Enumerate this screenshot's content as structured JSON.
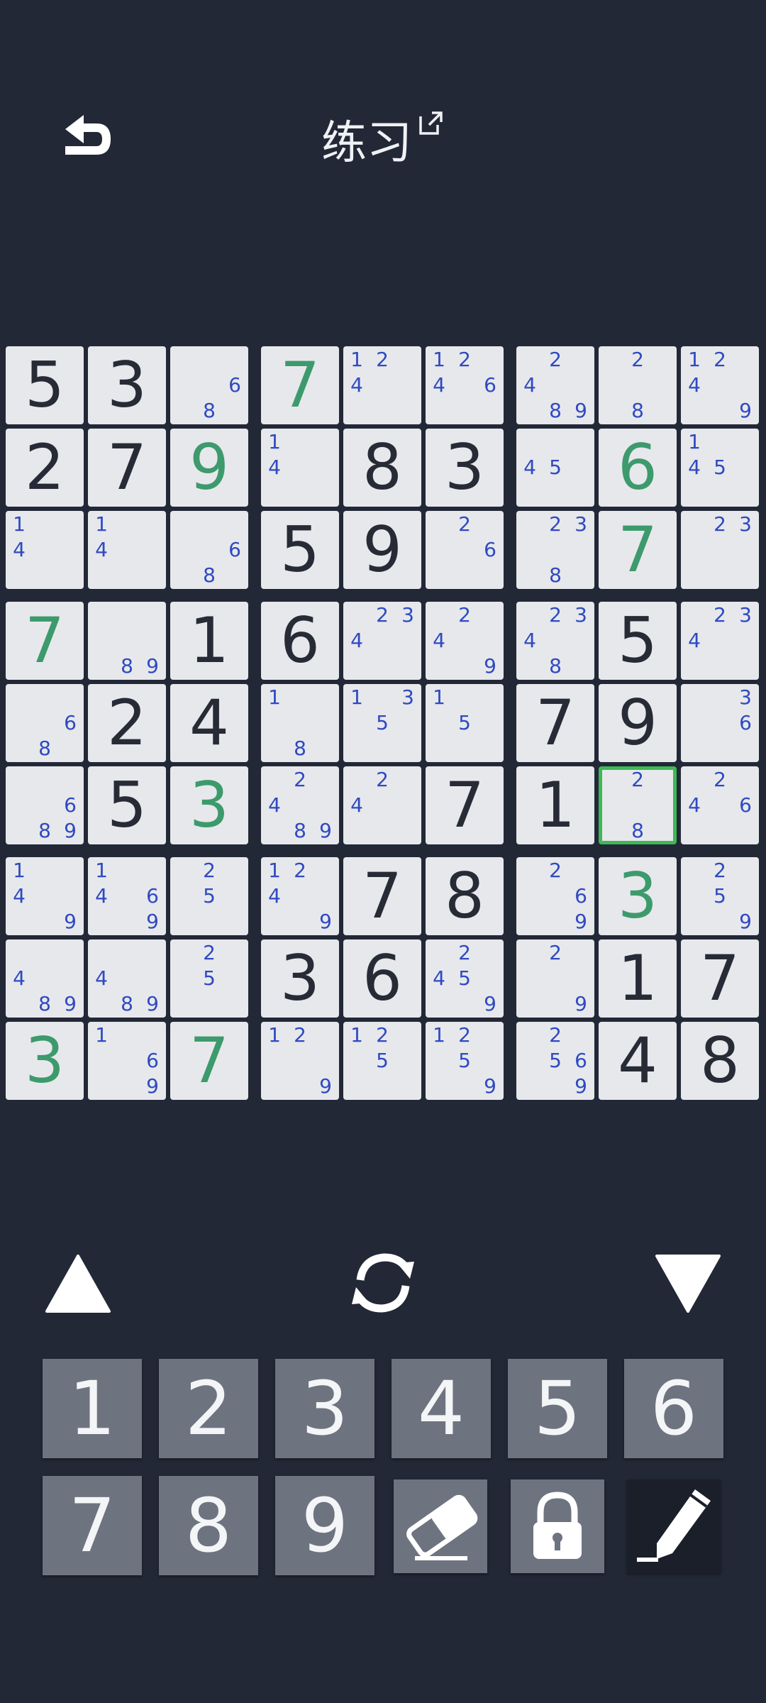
{
  "header": {
    "title": "练习"
  },
  "board": {
    "rows": [
      [
        {
          "v": "5",
          "t": "given"
        },
        {
          "v": "3",
          "t": "given"
        },
        {
          "n": [
            6,
            8
          ]
        },
        {
          "v": "7",
          "t": "entered"
        },
        {
          "n": [
            1,
            2,
            4
          ]
        },
        {
          "n": [
            1,
            2,
            4,
            6
          ]
        },
        {
          "n": [
            2,
            4,
            8,
            9
          ]
        },
        {
          "n": [
            2,
            8
          ]
        },
        {
          "n": [
            1,
            2,
            4,
            9
          ]
        }
      ],
      [
        {
          "v": "2",
          "t": "given"
        },
        {
          "v": "7",
          "t": "given"
        },
        {
          "v": "9",
          "t": "entered"
        },
        {
          "n": [
            1,
            4
          ]
        },
        {
          "v": "8",
          "t": "given"
        },
        {
          "v": "3",
          "t": "given"
        },
        {
          "n": [
            4,
            5
          ]
        },
        {
          "v": "6",
          "t": "entered"
        },
        {
          "n": [
            1,
            4,
            5
          ]
        }
      ],
      [
        {
          "n": [
            1,
            4
          ]
        },
        {
          "n": [
            1,
            4
          ]
        },
        {
          "n": [
            6,
            8
          ]
        },
        {
          "v": "5",
          "t": "given"
        },
        {
          "v": "9",
          "t": "given"
        },
        {
          "n": [
            2,
            6
          ]
        },
        {
          "n": [
            2,
            3,
            8
          ]
        },
        {
          "v": "7",
          "t": "entered"
        },
        {
          "n": [
            2,
            3
          ]
        }
      ],
      [
        {
          "v": "7",
          "t": "entered"
        },
        {
          "n": [
            8,
            9
          ]
        },
        {
          "v": "1",
          "t": "given"
        },
        {
          "v": "6",
          "t": "given"
        },
        {
          "n": [
            2,
            3,
            4
          ]
        },
        {
          "n": [
            2,
            4,
            9
          ]
        },
        {
          "n": [
            2,
            3,
            4,
            8
          ]
        },
        {
          "v": "5",
          "t": "given"
        },
        {
          "n": [
            2,
            3,
            4
          ]
        }
      ],
      [
        {
          "n": [
            6,
            8
          ]
        },
        {
          "v": "2",
          "t": "given"
        },
        {
          "v": "4",
          "t": "given"
        },
        {
          "n": [
            1,
            8
          ]
        },
        {
          "n": [
            1,
            3,
            5
          ]
        },
        {
          "n": [
            1,
            5
          ]
        },
        {
          "v": "7",
          "t": "given"
        },
        {
          "v": "9",
          "t": "given"
        },
        {
          "n": [
            3,
            6
          ]
        }
      ],
      [
        {
          "n": [
            6,
            8,
            9
          ]
        },
        {
          "v": "5",
          "t": "given"
        },
        {
          "v": "3",
          "t": "entered"
        },
        {
          "n": [
            2,
            4,
            8,
            9
          ]
        },
        {
          "n": [
            2,
            4
          ]
        },
        {
          "v": "7",
          "t": "given"
        },
        {
          "v": "1",
          "t": "given"
        },
        {
          "n": [
            2,
            8
          ],
          "sel": true
        },
        {
          "n": [
            2,
            4,
            6
          ]
        }
      ],
      [
        {
          "n": [
            1,
            4,
            9
          ]
        },
        {
          "n": [
            1,
            4,
            6,
            9
          ]
        },
        {
          "n": [
            2,
            5
          ]
        },
        {
          "n": [
            1,
            2,
            4,
            9
          ]
        },
        {
          "v": "7",
          "t": "given"
        },
        {
          "v": "8",
          "t": "given"
        },
        {
          "n": [
            2,
            6,
            9
          ]
        },
        {
          "v": "3",
          "t": "entered"
        },
        {
          "n": [
            2,
            5,
            9
          ]
        }
      ],
      [
        {
          "n": [
            4,
            8,
            9
          ]
        },
        {
          "n": [
            4,
            8,
            9
          ]
        },
        {
          "n": [
            2,
            5
          ]
        },
        {
          "v": "3",
          "t": "given"
        },
        {
          "v": "6",
          "t": "given"
        },
        {
          "n": [
            2,
            4,
            5,
            9
          ]
        },
        {
          "n": [
            2,
            9
          ]
        },
        {
          "v": "1",
          "t": "given"
        },
        {
          "v": "7",
          "t": "given"
        }
      ],
      [
        {
          "v": "3",
          "t": "entered"
        },
        {
          "n": [
            1,
            6,
            9
          ]
        },
        {
          "v": "7",
          "t": "entered"
        },
        {
          "n": [
            1,
            2,
            9
          ]
        },
        {
          "n": [
            1,
            2,
            5
          ]
        },
        {
          "n": [
            1,
            2,
            5,
            9
          ]
        },
        {
          "n": [
            2,
            5,
            6,
            9
          ]
        },
        {
          "v": "4",
          "t": "given"
        },
        {
          "v": "8",
          "t": "given"
        }
      ]
    ]
  },
  "keypad": {
    "digits": [
      "1",
      "2",
      "3",
      "4",
      "5",
      "6",
      "7",
      "8",
      "9"
    ]
  },
  "colors": {
    "background": "#222836",
    "cell": "#e7e8ec",
    "given": "#262b36",
    "entered": "#3d9a6c",
    "note": "#2f4ac0",
    "selected_border": "#3fb856",
    "keypad": "#6e7380"
  },
  "icons": {
    "back": "back-arrow-icon",
    "external": "external-link-icon",
    "prev": "triangle-up-icon",
    "refresh": "refresh-icon",
    "next": "triangle-down-icon",
    "erase": "eraser-icon",
    "lock": "lock-icon",
    "pencil": "pencil-icon"
  }
}
